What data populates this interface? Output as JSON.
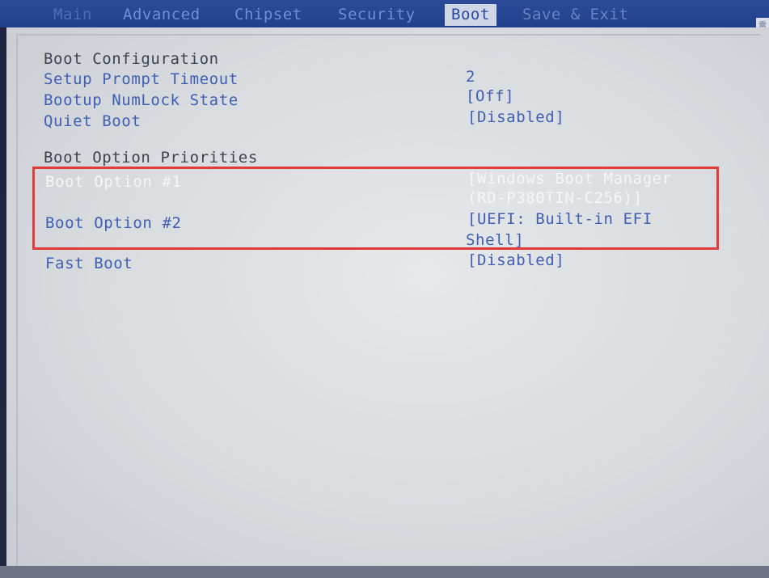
{
  "tabs": [
    {
      "label": "Main"
    },
    {
      "label": "Advanced"
    },
    {
      "label": "Chipset"
    },
    {
      "label": "Security"
    },
    {
      "label": "Boot"
    },
    {
      "label": "Save & Exit"
    }
  ],
  "active_tab": "Boot",
  "corner_glyph": "電",
  "boot_configuration": {
    "title": "Boot Configuration",
    "items": [
      {
        "label": "Setup Prompt Timeout",
        "value": "2"
      },
      {
        "label": "Bootup NumLock State",
        "value": "[Off]"
      },
      {
        "label": "Quiet Boot",
        "value": "[Disabled]"
      }
    ]
  },
  "boot_option_priorities": {
    "title": "Boot Option Priorities",
    "items": [
      {
        "label": "Boot Option #1",
        "value_line1": "[Windows Boot Manager",
        "value_line2": "(RD-P380TIN-C256)]"
      },
      {
        "label": "Boot Option #2",
        "value_line1": "[UEFI: Built-in EFI",
        "value_line2": "Shell]"
      }
    ]
  },
  "fast_boot": {
    "label": "Fast Boot",
    "value": "[Disabled]"
  },
  "colors": {
    "tab_bar": "#20408c",
    "panel_bg": "#dcdfe2",
    "label_blue": "#3f5fb4",
    "selected_text": "#f4f6f8",
    "highlight_border": "#e23a3a"
  }
}
